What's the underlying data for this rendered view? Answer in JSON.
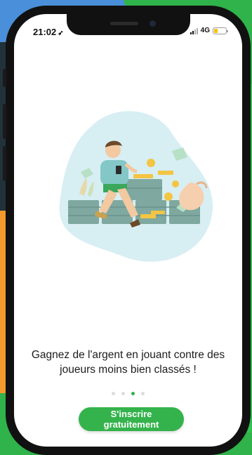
{
  "status_bar": {
    "time": "21:02",
    "location_glyph": "➶",
    "network": "4G",
    "battery_level": 0.3,
    "battery_color": "#f4c20d"
  },
  "onboarding": {
    "headline": "Gagnez de l'argent en jouant contre des joueurs moins bien classés !",
    "pages": 4,
    "active_page": 3,
    "cta_label": "S'inscrire gratuitement"
  },
  "colors": {
    "accent": "#34b34c",
    "text": "#1c1c1c",
    "dot_inactive": "#dcdcdc"
  },
  "icons": [
    "location-arrow-icon",
    "signal-icon",
    "battery-icon"
  ]
}
